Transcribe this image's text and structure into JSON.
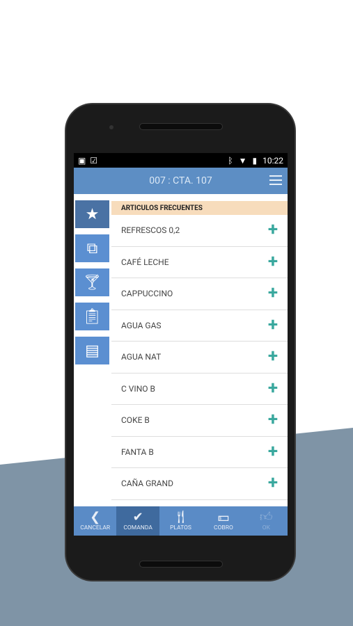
{
  "status": {
    "time": "10:22"
  },
  "header": {
    "title": "007 : CTA. 107"
  },
  "sidebar": {
    "items": [
      {
        "icon": "star-icon",
        "active": true
      },
      {
        "icon": "hierarchy-icon"
      },
      {
        "icon": "cocktail-icon"
      },
      {
        "icon": "clipboard-icon"
      },
      {
        "icon": "clipboard-list-icon"
      }
    ]
  },
  "list": {
    "header": "ARTICULOS FRECUENTES",
    "items": [
      "REFRESCOS 0,2",
      "CAFÉ LECHE",
      "CAPPUCCINO",
      "AGUA GAS",
      "AGUA NAT",
      "C VINO B",
      "COKE B",
      "FANTA B",
      "CAÑA GRAND"
    ]
  },
  "bottom_nav": [
    {
      "label": "CANCELAR",
      "icon": "chevron-left-icon"
    },
    {
      "label": "COMANDA",
      "icon": "double-check-icon",
      "active": true
    },
    {
      "label": "PLATOS",
      "icon": "cutlery-icon"
    },
    {
      "label": "COBRO",
      "icon": "money-icon"
    },
    {
      "label": "OK",
      "icon": "thumbs-up-icon",
      "disabled": true
    }
  ],
  "colors": {
    "appbar": "#5d8ec4",
    "accent_plus": "#3aa89e",
    "list_header": "#f7dcbc"
  }
}
